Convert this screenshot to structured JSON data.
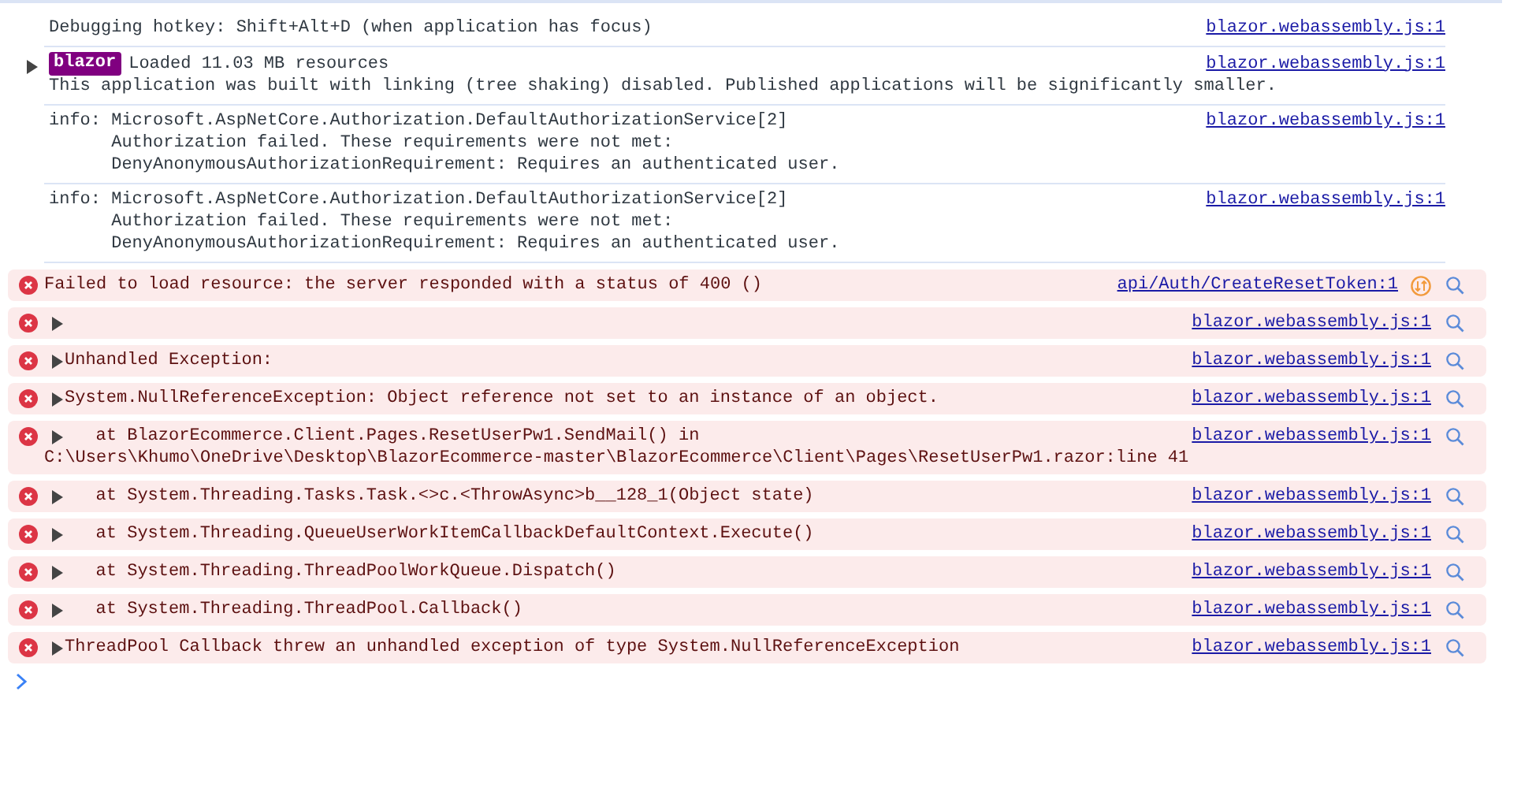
{
  "messages": [
    {
      "kind": "log",
      "expandable": false,
      "lines": [
        "Debugging hotkey: Shift+Alt+D (when application has focus)"
      ],
      "source": "blazor.webassembly.js:1"
    },
    {
      "kind": "log",
      "expandable": true,
      "badge": "blazor",
      "lines": [
        "Loaded 11.03 MB resources",
        "This application was built with linking (tree shaking) disabled. Published applications will be significantly smaller."
      ],
      "source": "blazor.webassembly.js:1"
    },
    {
      "kind": "log",
      "expandable": false,
      "lines": [
        "info: Microsoft.AspNetCore.Authorization.DefaultAuthorizationService[2]",
        "      Authorization failed. These requirements were not met:",
        "      DenyAnonymousAuthorizationRequirement: Requires an authenticated user."
      ],
      "source": "blazor.webassembly.js:1"
    },
    {
      "kind": "log",
      "expandable": false,
      "lines": [
        "info: Microsoft.AspNetCore.Authorization.DefaultAuthorizationService[2]",
        "      Authorization failed. These requirements were not met:",
        "      DenyAnonymousAuthorizationRequirement: Requires an authenticated user."
      ],
      "source": "blazor.webassembly.js:1"
    },
    {
      "kind": "error",
      "expandable": false,
      "network": true,
      "lines": [
        "Failed to load resource: the server responded with a status of 400 ()"
      ],
      "source": "api/Auth/CreateResetToken:1"
    },
    {
      "kind": "error",
      "expandable": true,
      "network": false,
      "source": "blazor.webassembly.js:1"
    },
    {
      "kind": "error",
      "expandable": true,
      "network": false,
      "lines": [
        "Unhandled Exception:"
      ],
      "source": "blazor.webassembly.js:1"
    },
    {
      "kind": "error",
      "expandable": true,
      "network": false,
      "lines": [
        "System.NullReferenceException: Object reference not set to an instance of an object."
      ],
      "source": "blazor.webassembly.js:1"
    },
    {
      "kind": "error",
      "expandable": true,
      "network": false,
      "lines": [
        "   at BlazorEcommerce.Client.Pages.ResetUserPw1.SendMail() in",
        "C:\\Users\\Khumo\\OneDrive\\Desktop\\BlazorEcommerce-master\\BlazorEcommerce\\Client\\Pages\\ResetUserPw1.razor:line 41"
      ],
      "source": "blazor.webassembly.js:1"
    },
    {
      "kind": "error",
      "expandable": true,
      "network": false,
      "lines": [
        "   at System.Threading.Tasks.Task.<>c.<ThrowAsync>b__128_1(Object state)"
      ],
      "source": "blazor.webassembly.js:1"
    },
    {
      "kind": "error",
      "expandable": true,
      "network": false,
      "lines": [
        "   at System.Threading.QueueUserWorkItemCallbackDefaultContext.Execute()"
      ],
      "source": "blazor.webassembly.js:1"
    },
    {
      "kind": "error",
      "expandable": true,
      "network": false,
      "lines": [
        "   at System.Threading.ThreadPoolWorkQueue.Dispatch()"
      ],
      "source": "blazor.webassembly.js:1"
    },
    {
      "kind": "error",
      "expandable": true,
      "network": false,
      "lines": [
        "   at System.Threading.ThreadPool.Callback()"
      ],
      "source": "blazor.webassembly.js:1"
    },
    {
      "kind": "error",
      "expandable": true,
      "network": false,
      "lines": [
        "ThreadPool Callback threw an unhandled exception of type System.NullReferenceException"
      ],
      "source": "blazor.webassembly.js:1"
    }
  ]
}
